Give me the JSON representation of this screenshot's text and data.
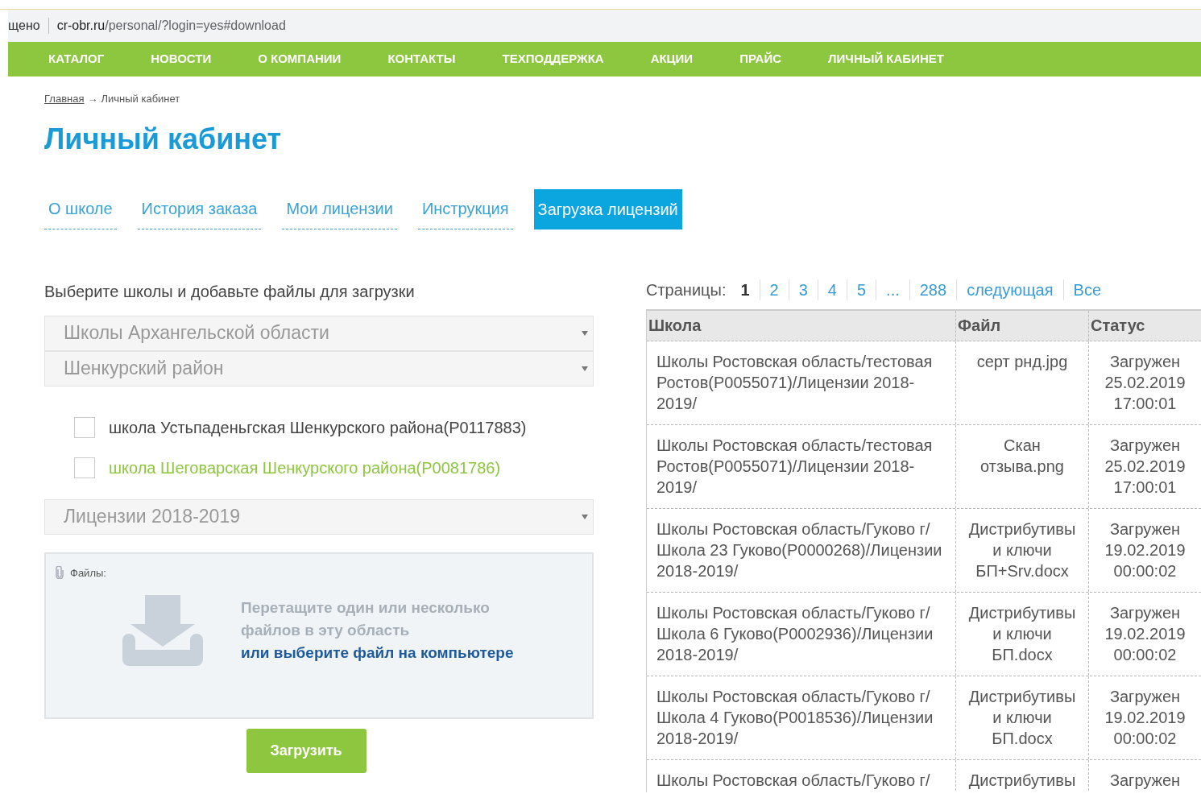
{
  "address_bar": {
    "prefix": "щено",
    "host": "cr-obr.ru",
    "path": "/personal/?login=yes#download"
  },
  "nav": [
    "КАТАЛОГ",
    "НОВОСТИ",
    "О КОМПАНИИ",
    "КОНТАКТЫ",
    "ТЕХПОДДЕРЖКА",
    "АКЦИИ",
    "ПРАЙС",
    "ЛИЧНЫЙ КАБИНЕТ"
  ],
  "breadcrumb": {
    "link": "Главная",
    "separator": "→",
    "current": "Личный кабинет"
  },
  "title": "Личный кабинет",
  "tabs": [
    {
      "label": "О школе",
      "selected": false
    },
    {
      "label": "История заказа",
      "selected": false
    },
    {
      "label": "Мои лицензии",
      "selected": false
    },
    {
      "label": "Инструкция",
      "selected": false
    },
    {
      "label": "Загрузка лицензий",
      "selected": true
    }
  ],
  "form": {
    "heading": "Выберите школы и добавьте файлы для загрузки",
    "selects": [
      "Школы Архангельской области",
      "Шенкурский район"
    ],
    "schools": [
      {
        "label": "школа Устьпаденьгская Шенкурского района(P0117883)",
        "checked": false,
        "highlighted": false
      },
      {
        "label": "школа Шеговарская Шенкурского района(P0081786)",
        "checked": false,
        "highlighted": true
      }
    ],
    "license_select": "Лицензии 2018-2019",
    "dropzone": {
      "label": "Файлы:",
      "hint": "Перетащите один или несколько файлов в эту область",
      "link": "или выберите файл на компьютере"
    },
    "submit": "Загрузить"
  },
  "pagination": {
    "label": "Страницы:",
    "pages": [
      {
        "label": "1",
        "selected": true
      },
      {
        "label": "2",
        "selected": false
      },
      {
        "label": "3",
        "selected": false
      },
      {
        "label": "4",
        "selected": false
      },
      {
        "label": "5",
        "selected": false
      },
      {
        "label": "...",
        "selected": false
      },
      {
        "label": "288",
        "selected": false
      },
      {
        "label": "следующая",
        "selected": false
      },
      {
        "label": "Все",
        "selected": false
      }
    ]
  },
  "table": {
    "columns": [
      "Школа",
      "Файл",
      "Статус"
    ],
    "rows": [
      [
        "Школы Ростовская область/тестовая Ростов(P0055071)/Лицензии 2018-2019/",
        "серт рнд.jpg",
        "Загружен 25.02.2019 17:00:01"
      ],
      [
        "Школы Ростовская область/тестовая Ростов(P0055071)/Лицензии 2018-2019/",
        "Скан отзыва.png",
        "Загружен 25.02.2019 17:00:01"
      ],
      [
        "Школы Ростовская область/Гуково г/ Школа 23 Гуково(P0000268)/Лицензии 2018-2019/",
        "Дистрибутивы и ключи БП+Srv.docx",
        "Загружен 19.02.2019 00:00:02"
      ],
      [
        "Школы Ростовская область/Гуково г/ Школа 6 Гуково(P0002936)/Лицензии 2018-2019/",
        "Дистрибутивы и ключи БП.docx",
        "Загружен 19.02.2019 00:00:02"
      ],
      [
        "Школы Ростовская область/Гуково г/ Школа 4 Гуково(P0018536)/Лицензии 2018-2019/",
        "Дистрибутивы и ключи БП.docx",
        "Загружен 19.02.2019 00:00:02"
      ],
      [
        "Школы Ростовская область/Гуково г/",
        "Дистрибутивы",
        "Загружен"
      ]
    ]
  }
}
